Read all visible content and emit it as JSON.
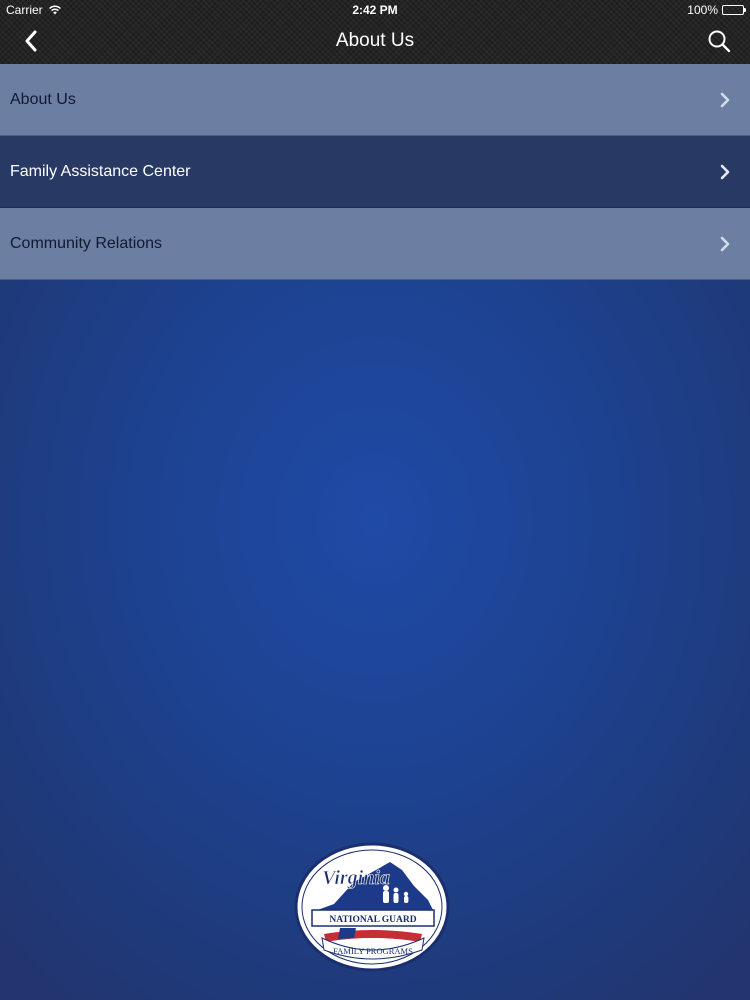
{
  "status_bar": {
    "carrier": "Carrier",
    "time": "2:42 PM",
    "battery": "100%"
  },
  "nav": {
    "title": "About Us",
    "back_icon": "chevron-left-icon",
    "search_icon": "search-icon"
  },
  "menu": {
    "items": [
      {
        "label": "About Us"
      },
      {
        "label": "Family Assistance Center"
      },
      {
        "label": "Community Relations"
      }
    ]
  },
  "logo": {
    "top_text": "Virginia",
    "band_text": "NATIONAL GUARD",
    "bottom_text": "FAMILY PROGRAMS"
  },
  "colors": {
    "background": "#1f4aa6",
    "topbar": "#232323",
    "row_light": "#6c7ea1",
    "row_dark": "#283a63"
  }
}
